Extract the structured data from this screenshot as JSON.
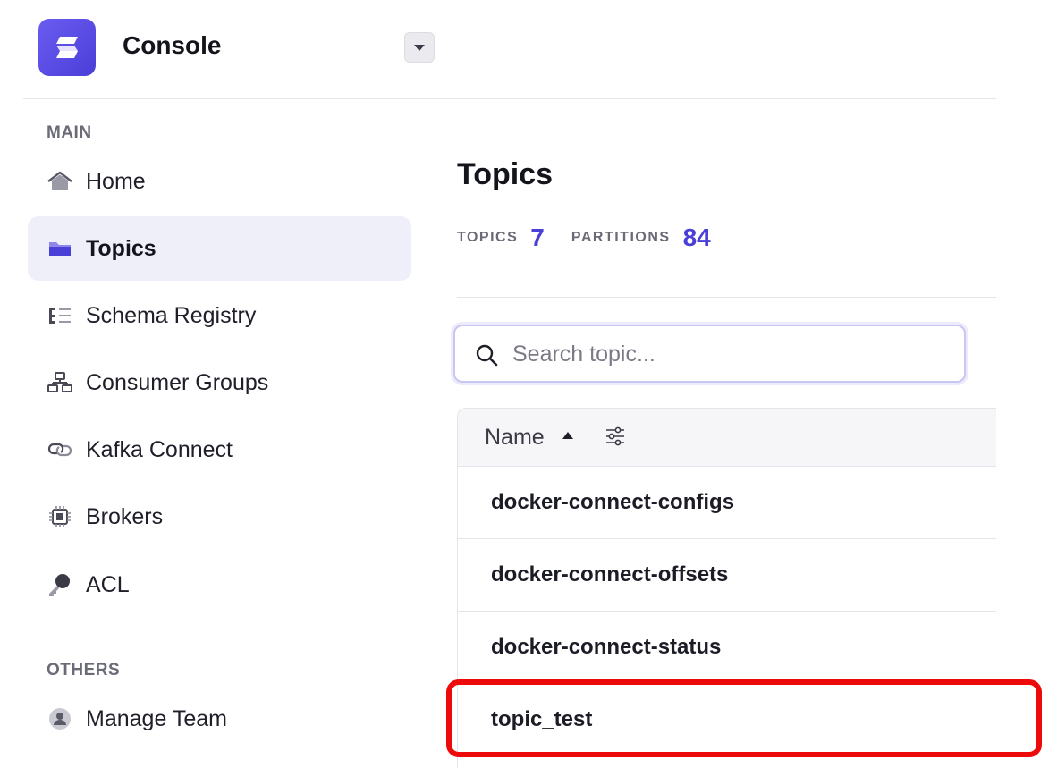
{
  "header": {
    "app_title": "Console",
    "logo_icon": "console-logo-icon",
    "dropdown_icon": "caret-down-icon"
  },
  "sidebar": {
    "main_section_label": "MAIN",
    "others_section_label": "OTHERS",
    "items": [
      {
        "label": "Home",
        "icon": "home-icon",
        "active": false
      },
      {
        "label": "Topics",
        "icon": "folder-icon",
        "active": true
      },
      {
        "label": "Schema Registry",
        "icon": "schema-icon",
        "active": false
      },
      {
        "label": "Consumer Groups",
        "icon": "consumer-groups-icon",
        "active": false
      },
      {
        "label": "Kafka Connect",
        "icon": "link-icon",
        "active": false
      },
      {
        "label": "Brokers",
        "icon": "chip-icon",
        "active": false
      },
      {
        "label": "ACL",
        "icon": "key-icon",
        "active": false
      }
    ],
    "others_items": [
      {
        "label": "Manage Team",
        "icon": "user-icon",
        "active": false
      }
    ]
  },
  "main": {
    "title": "Topics",
    "stats": {
      "topics_label": "TOPICS",
      "topics_value": "7",
      "partitions_label": "PARTITIONS",
      "partitions_value": "84"
    },
    "search": {
      "placeholder": "Search topic...",
      "value": ""
    },
    "table": {
      "columns": [
        "Name"
      ],
      "rows": [
        {
          "name": "docker-connect-configs"
        },
        {
          "name": "docker-connect-offsets"
        },
        {
          "name": "docker-connect-status"
        },
        {
          "name": "topic_test"
        }
      ]
    }
  },
  "colors": {
    "accent": "#4a3fd6",
    "active_bg": "#efeffa",
    "highlight": "#ee0a0a"
  }
}
